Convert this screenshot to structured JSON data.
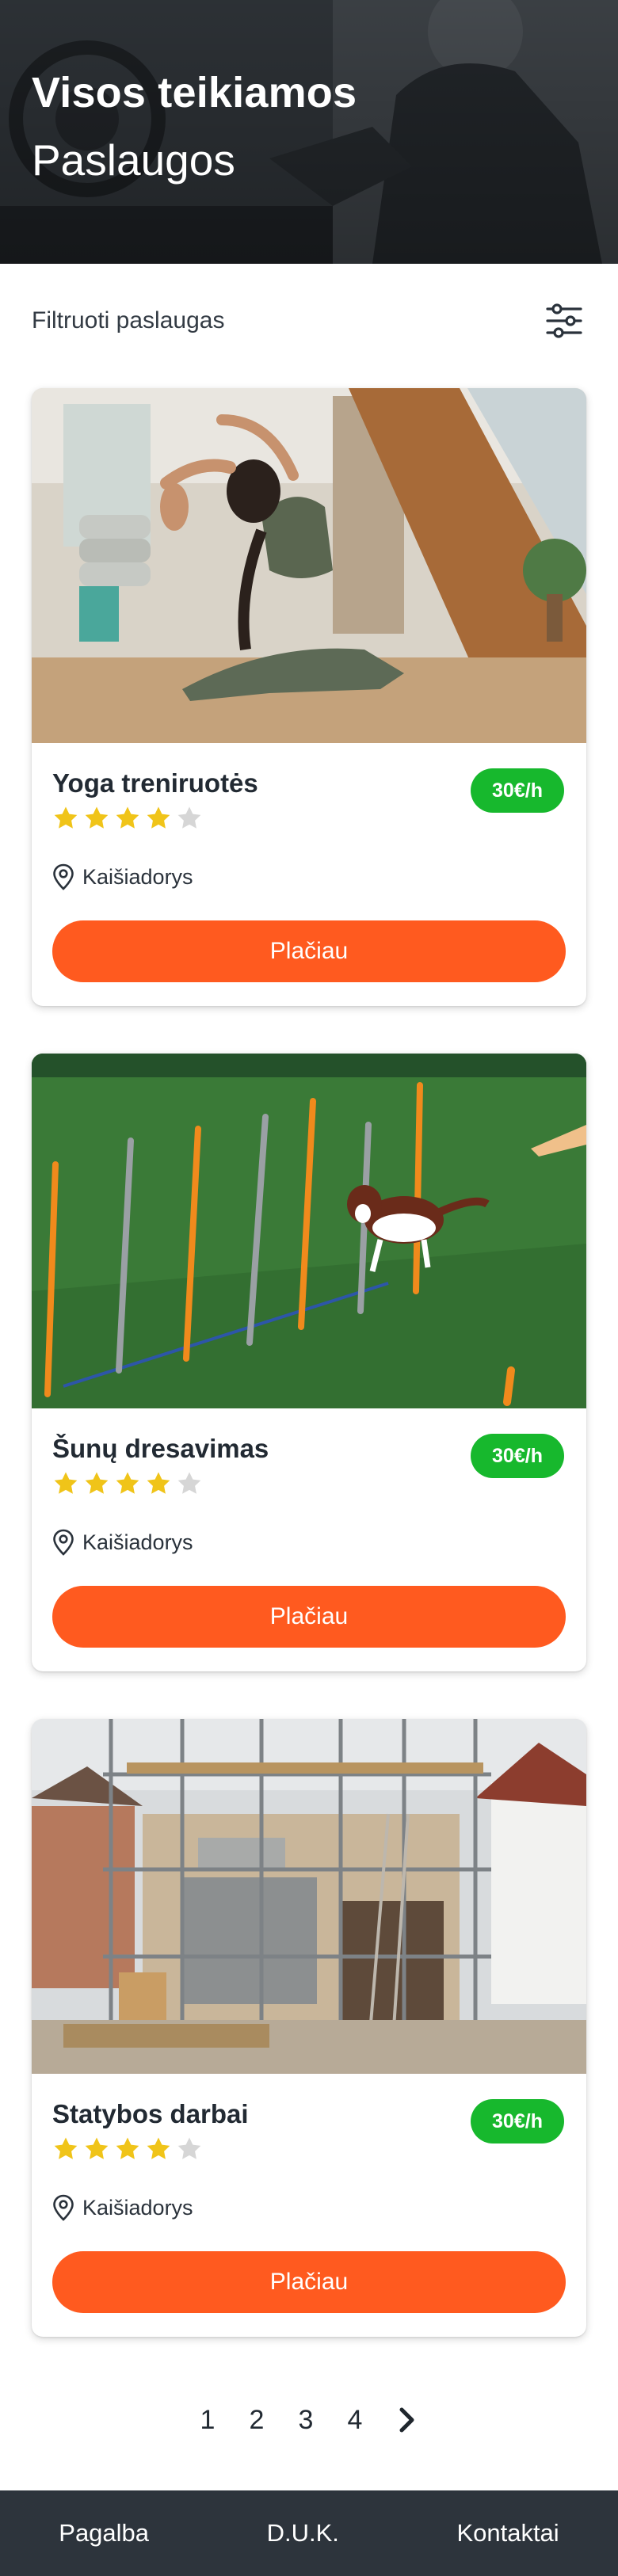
{
  "hero": {
    "title": "Visos teikiamos",
    "subtitle": "Paslaugos"
  },
  "filter": {
    "label": "Filtruoti paslaugas",
    "icon": "sliders-icon"
  },
  "services": [
    {
      "title": "Yoga treniruotės",
      "price": "30€/h",
      "rating": 4,
      "rating_max": 5,
      "location": "Kaišiadorys",
      "button_label": "Plačiau",
      "image": "yoga-photo"
    },
    {
      "title": "Šunų dresavimas",
      "price": "30€/h",
      "rating": 4,
      "rating_max": 5,
      "location": "Kaišiadorys",
      "button_label": "Plačiau",
      "image": "dog-agility-photo"
    },
    {
      "title": "Statybos darbai",
      "price": "30€/h",
      "rating": 4,
      "rating_max": 5,
      "location": "Kaišiadorys",
      "button_label": "Plačiau",
      "image": "construction-photo"
    }
  ],
  "pagination": {
    "pages": [
      "1",
      "2",
      "3",
      "4"
    ],
    "next_icon": "chevron-right-icon"
  },
  "footer": {
    "links": [
      "Pagalba",
      "D.U.K.",
      "Kontaktai"
    ]
  },
  "colors": {
    "accent": "#ff5a1f",
    "price_badge": "#17b82d",
    "star_filled": "#f0c419",
    "star_empty": "#d6d6d6",
    "footer_bg": "#2d343c"
  }
}
